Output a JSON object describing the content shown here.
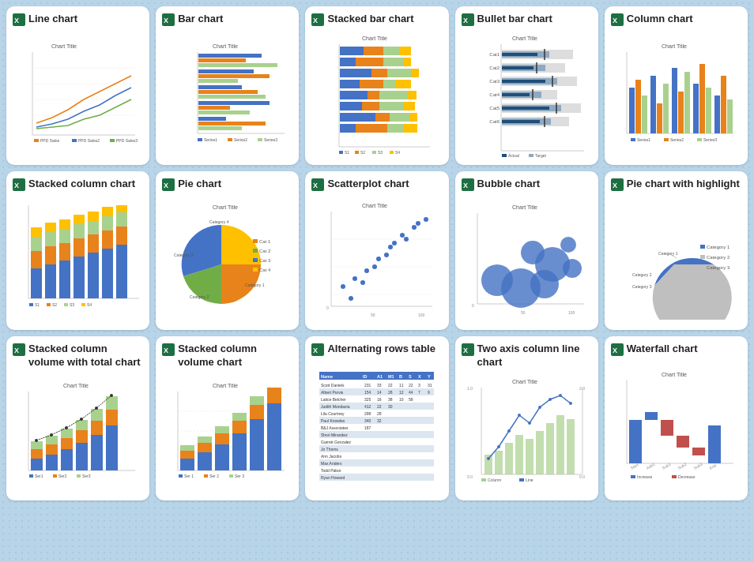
{
  "cards": [
    {
      "id": "line-chart",
      "title": "Line chart",
      "type": "line"
    },
    {
      "id": "bar-chart",
      "title": "Bar chart",
      "type": "bar"
    },
    {
      "id": "stacked-bar-chart",
      "title": "Stacked bar chart",
      "type": "stacked-bar"
    },
    {
      "id": "bullet-bar-chart",
      "title": "Bullet bar chart",
      "type": "bullet-bar"
    },
    {
      "id": "column-chart",
      "title": "Column chart",
      "type": "column"
    },
    {
      "id": "stacked-column-chart",
      "title": "Stacked column chart",
      "type": "stacked-column"
    },
    {
      "id": "pie-chart",
      "title": "Pie chart",
      "type": "pie"
    },
    {
      "id": "scatterplot-chart",
      "title": "Scatterplot chart",
      "type": "scatter"
    },
    {
      "id": "bubble-chart",
      "title": "Bubble chart",
      "type": "bubble"
    },
    {
      "id": "pie-highlight-chart",
      "title": "Pie chart with highlight",
      "type": "pie-highlight"
    },
    {
      "id": "stacked-column-volume",
      "title": "Stacked column volume with total chart",
      "type": "stacked-col-vol"
    },
    {
      "id": "stacked-column-volume-chart",
      "title": "Stacked column volume chart",
      "type": "stacked-col-vol2"
    },
    {
      "id": "alternating-rows",
      "title": "Alternating rows table",
      "type": "table"
    },
    {
      "id": "two-axis-column-line",
      "title": "Two axis column line chart",
      "type": "two-axis"
    },
    {
      "id": "waterfall-chart",
      "title": "Waterfall chart",
      "type": "waterfall"
    }
  ]
}
